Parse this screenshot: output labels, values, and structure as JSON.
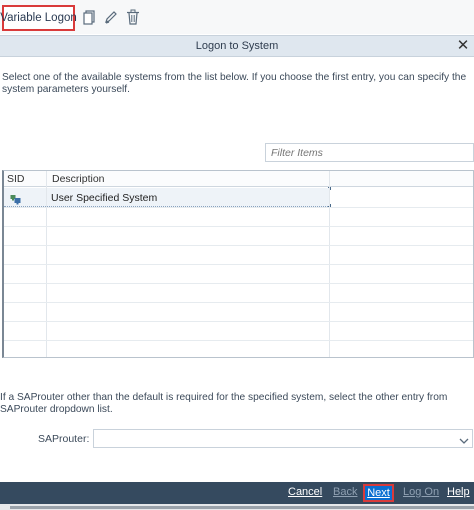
{
  "toolbar": {
    "variable_logon_label": "Variable Logon",
    "icons": [
      "copy-icon",
      "edit-pencil-icon",
      "trash-icon"
    ]
  },
  "dialog": {
    "title": "Logon to System",
    "close_symbol": "✕"
  },
  "instructions": "Select one of the available systems from the list below. If you choose the first entry, you can specify the system parameters yourself.",
  "filter": {
    "placeholder": "Filter Items",
    "value": ""
  },
  "table": {
    "columns": [
      "SID",
      "Description"
    ],
    "rows": [
      {
        "sid_icon": "system-icon",
        "description": "User Specified System",
        "selected": true
      }
    ]
  },
  "saprouter": {
    "note": "If a SAProuter other than the default is required for the specified system, select the other entry from SAProuter dropdown list.",
    "label": "SAProuter:",
    "value": ""
  },
  "footer": {
    "cancel": "Cancel",
    "back": "Back",
    "next": "Next",
    "logon": "Log On",
    "help": "Help"
  },
  "colors": {
    "footer_bg": "#354a5f",
    "accent_blue": "#0a6ed1",
    "highlight_red": "#d93a3a",
    "header_bg": "#dfe7ef"
  }
}
